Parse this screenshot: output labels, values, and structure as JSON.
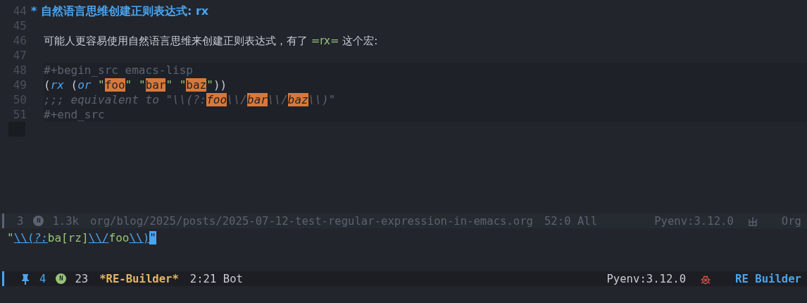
{
  "editor": {
    "lines": [
      {
        "number": "44",
        "kind": "heading",
        "segments": [
          {
            "text": "* ",
            "kind": "bullet"
          },
          {
            "text": "自然语言思维创建正则表达式: rx",
            "kind": "heading"
          }
        ]
      },
      {
        "number": "45"
      },
      {
        "number": "46",
        "kind": "body",
        "segments": [
          {
            "text": "可能人更容易使用自然语言思维来创建正则表达式，有了 ",
            "kind": "prose"
          },
          {
            "text": "=rx=",
            "kind": "verbatim"
          },
          {
            "text": " 这个宏:",
            "kind": "prose"
          }
        ]
      },
      {
        "number": "47"
      },
      {
        "number": "48",
        "kind": "body",
        "block": true,
        "segments": [
          {
            "text": "#+begin_src emacs-lisp",
            "kind": "meta"
          }
        ]
      },
      {
        "number": "49",
        "kind": "body",
        "block": true,
        "segments": [
          {
            "text": "(",
            "kind": "plain"
          },
          {
            "text": "rx",
            "kind": "keyword"
          },
          {
            "text": " (",
            "kind": "plain"
          },
          {
            "text": "or",
            "kind": "keyword"
          },
          {
            "text": " \"",
            "kind": "string"
          },
          {
            "text": "foo",
            "kind": "match"
          },
          {
            "text": "\" \"",
            "kind": "string"
          },
          {
            "text": "bar",
            "kind": "match"
          },
          {
            "text": "\" \"",
            "kind": "string"
          },
          {
            "text": "baz",
            "kind": "match"
          },
          {
            "text": "\"",
            "kind": "string"
          },
          {
            "text": "))",
            "kind": "plain"
          }
        ]
      },
      {
        "number": "50",
        "kind": "body",
        "block": true,
        "segments": [
          {
            "text": ";;; equivalent to \"\\\\(?:",
            "kind": "comment"
          },
          {
            "text": "foo",
            "kind": "comment-match"
          },
          {
            "text": "\\\\/",
            "kind": "comment"
          },
          {
            "text": "bar",
            "kind": "comment-match"
          },
          {
            "text": "\\\\/",
            "kind": "comment"
          },
          {
            "text": "baz",
            "kind": "comment-match"
          },
          {
            "text": "\\\\)\"",
            "kind": "comment"
          }
        ]
      },
      {
        "number": "51",
        "kind": "body",
        "block": true,
        "segments": [
          {
            "text": "#+end_src",
            "kind": "meta"
          }
        ]
      },
      {
        "current": true
      }
    ]
  },
  "mode_line_1": {
    "active": false,
    "window_number": "3",
    "state_badge": "N",
    "size": "1.3k",
    "buffer_name": "org/blog/2025/posts/2025-07-12-test-regular-expression-in-emacs.org",
    "position": "52:0 All",
    "env": "Pyenv:3.12.0",
    "major_mode": "Org"
  },
  "regex_input": {
    "segments": [
      {
        "text": "\"",
        "kind": "quote"
      },
      {
        "text": "\\\\(",
        "kind": "group"
      },
      {
        "text": "?:",
        "kind": "group-italic"
      },
      {
        "text": "ba[rz]",
        "kind": "text"
      },
      {
        "text": "\\\\/",
        "kind": "group"
      },
      {
        "text": "foo",
        "kind": "text"
      },
      {
        "text": "\\\\)",
        "kind": "group"
      },
      {
        "text": "\"",
        "kind": "cursor"
      }
    ]
  },
  "mode_line_2": {
    "active": true,
    "window_number": "4",
    "state_badge": "N",
    "size": "23",
    "buffer_name": "*RE-Builder*",
    "position": "2:21 Bot",
    "env": "Pyenv:3.12.0",
    "major_mode": "RE Builder"
  }
}
